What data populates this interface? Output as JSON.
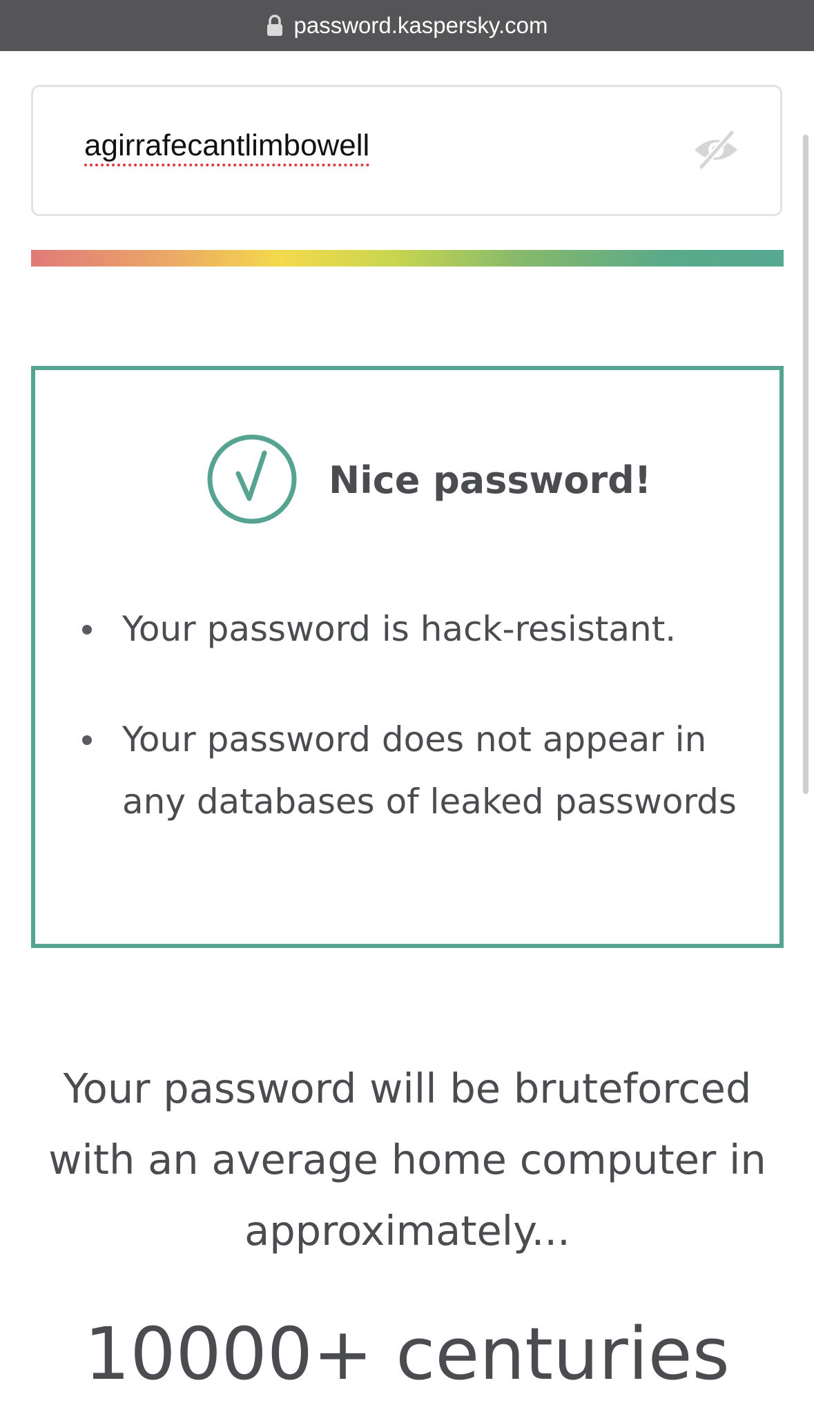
{
  "browser": {
    "url": "password.kaspersky.com",
    "lock_icon": "lock-icon"
  },
  "password_field": {
    "value": "agirrafecantlimbowell",
    "visibility_icon": "eye-slash-icon"
  },
  "strength_meter": {
    "level": 1.0,
    "colors": [
      "#e07a79",
      "#eaa766",
      "#f4d94c",
      "#c9d64f",
      "#86b96b",
      "#56a88f"
    ]
  },
  "result": {
    "border_color": "#56a392",
    "icon": "check-circle-icon",
    "title": "Nice password!",
    "items": [
      "Your password is hack-resistant.",
      "Your password does not appear in any databases of leaked passwords"
    ]
  },
  "bruteforce": {
    "description": "Your password will be bruteforced with an average home computer in approximately...",
    "time": "10000+ centuries"
  }
}
